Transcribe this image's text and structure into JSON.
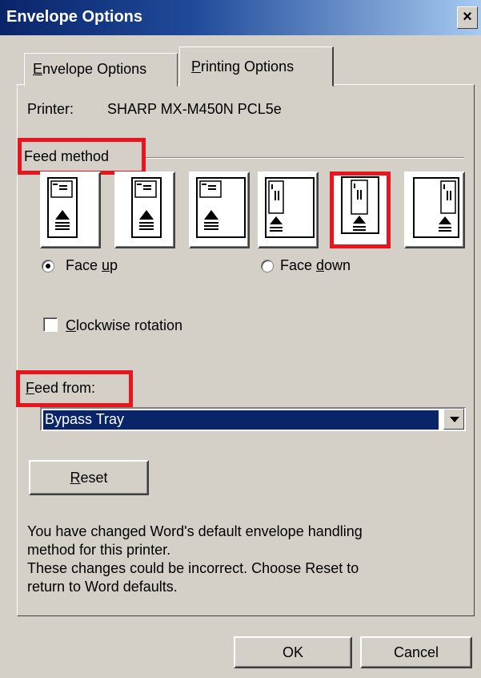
{
  "window": {
    "title": "Envelope Options",
    "close_glyph": "×"
  },
  "tabs": [
    {
      "label": "Envelope Options",
      "mnemonic_prefix": "",
      "mnemonic": "E",
      "rest": "nvelope Options",
      "active": false
    },
    {
      "label": "Printing Options",
      "mnemonic_prefix": "",
      "mnemonic": "P",
      "rest": "rinting Options",
      "active": true
    }
  ],
  "printer": {
    "label": "Printer:",
    "name": "SHARP MX-M450N PCL5e"
  },
  "feed_method": {
    "label": "Feed method",
    "options": [
      {
        "orientation": "horizontal",
        "align": "left"
      },
      {
        "orientation": "horizontal",
        "align": "center"
      },
      {
        "orientation": "horizontal",
        "align": "right"
      },
      {
        "orientation": "vertical",
        "align": "left"
      },
      {
        "orientation": "vertical",
        "align": "center",
        "selected": true
      },
      {
        "orientation": "vertical",
        "align": "right"
      }
    ],
    "face_up": {
      "prefix": "Face ",
      "mnemonic": "u",
      "rest": "p",
      "checked": true
    },
    "face_down": {
      "prefix": "Face ",
      "mnemonic": "d",
      "rest": "own",
      "checked": false
    }
  },
  "clockwise": {
    "prefix": "",
    "mnemonic": "C",
    "rest": "lockwise rotation",
    "checked": false
  },
  "feed_from": {
    "prefix": "",
    "mnemonic": "F",
    "rest": "eed from:",
    "value": "Bypass Tray"
  },
  "reset_button": {
    "prefix": "",
    "mnemonic": "R",
    "rest": "eset"
  },
  "info_lines": [
    "You have changed Word's default envelope handling",
    "method for this printer.",
    "These changes could be incorrect. Choose Reset to",
    "return to Word defaults."
  ],
  "footer": {
    "ok_label": "OK",
    "cancel_label": "Cancel"
  },
  "colors": {
    "title_bar": "#0a246a",
    "highlight_red": "#e8141e",
    "dialog_bg": "#d4d0c8",
    "selection": "#0a246a"
  }
}
